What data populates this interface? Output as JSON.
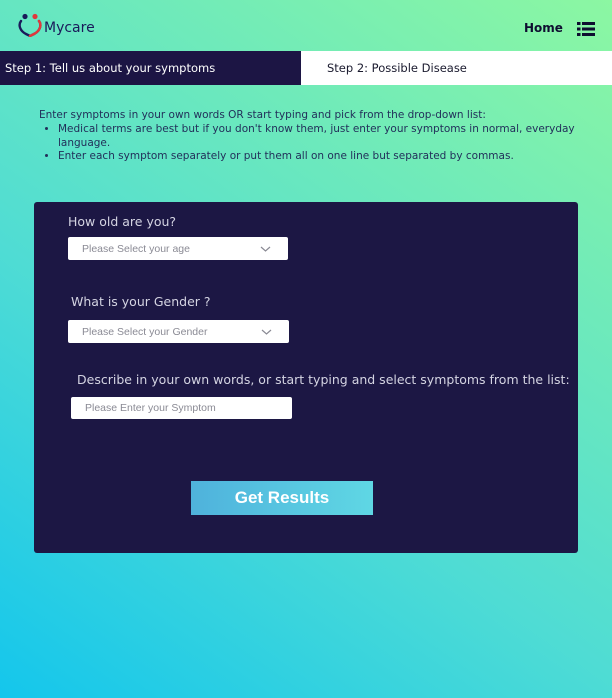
{
  "header": {
    "brand": "Mycare",
    "nav_home": "Home",
    "logo_icon": "heart-people-logo-icon",
    "menu_icon": "list-menu-icon"
  },
  "steps": {
    "step1": "Step 1: Tell us about your symptoms",
    "step2": "Step 2: Possible Disease"
  },
  "intro": {
    "lead": "Enter symptoms in your own words OR start typing and pick from the drop-down list:",
    "bullets": [
      "Medical terms are best but if you don't know them, just enter your symptoms in normal, everyday language.",
      "Enter each symptom separately or put them all on one line but separated by commas."
    ]
  },
  "form": {
    "age_question": "How old are you?",
    "age_select": "Please Select your age",
    "gender_question": "What is your Gender ?",
    "gender_select": "Please Select your Gender",
    "symptom_question": "Describe in your own words, or start typing and select symptoms from the list:",
    "symptom_placeholder": "Please Enter your Symptom",
    "submit_label": "Get Results"
  },
  "colors": {
    "card_bg": "#1c1744",
    "step_active_bg": "#1c1544",
    "button_gradient_start": "#4fb2dc",
    "button_gradient_end": "#5fd7e4",
    "bg_gradient_start": "#14c6ec",
    "bg_gradient_end": "#8cf7a2"
  }
}
